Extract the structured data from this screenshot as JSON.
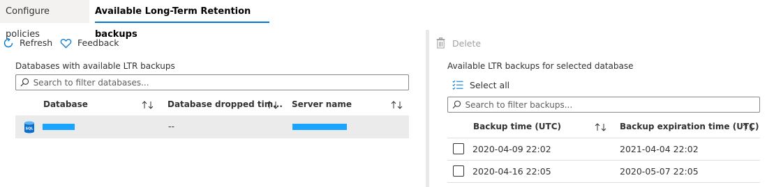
{
  "tabs": [
    {
      "label": "Configure policies"
    },
    {
      "label": "Available Long-Term Retention backups"
    }
  ],
  "left": {
    "toolbar": {
      "refresh_label": "Refresh",
      "feedback_label": "Feedback"
    },
    "section_title": "Databases with available LTR backups",
    "search": {
      "placeholder": "Search to filter databases..."
    },
    "columns": {
      "database": "Database",
      "dropped_time": "Database dropped tim...",
      "server_name": "Server name"
    },
    "rows": [
      {
        "icon_label": "SQL",
        "database": "",
        "dropped_time": "--",
        "server_name": ""
      }
    ]
  },
  "right": {
    "toolbar": {
      "delete_label": "Delete"
    },
    "section_title": "Available LTR backups for selected database",
    "select_all_label": "Select all",
    "search": {
      "placeholder": "Search to filter backups..."
    },
    "columns": {
      "backup_time": "Backup time (UTC)",
      "expiration_time": "Backup expiration time (UTC)"
    },
    "rows": [
      {
        "backup_time": "2020-04-09 22:02",
        "expiration_time": "2021-04-04 22:02"
      },
      {
        "backup_time": "2020-04-16 22:05",
        "expiration_time": "2020-05-07 22:05"
      }
    ]
  },
  "colors": {
    "accent": "#0078d4",
    "redaction": "#1aa3ff",
    "selected_row": "#ebebeb"
  }
}
